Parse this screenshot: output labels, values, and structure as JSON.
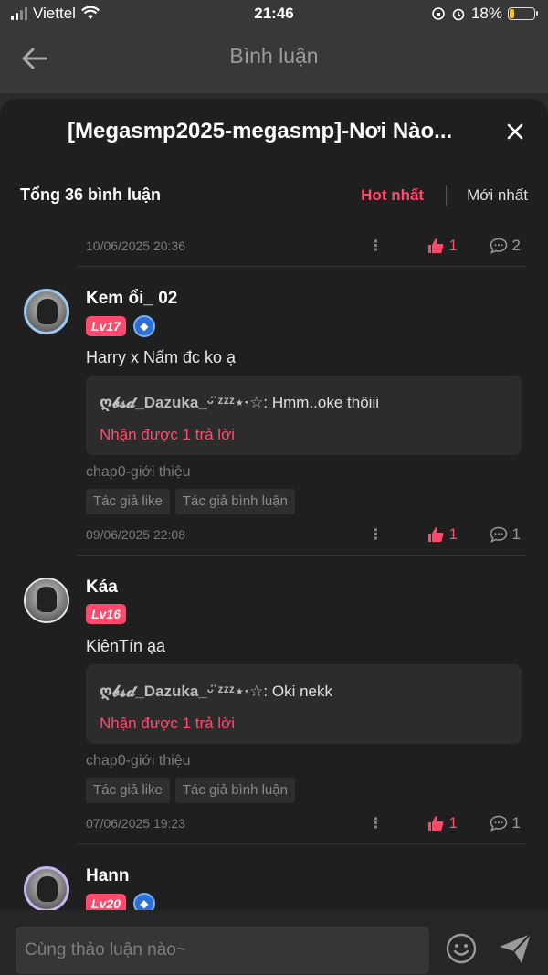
{
  "status": {
    "carrier": "Viettel",
    "time": "21:46",
    "battery": "18%",
    "battery_level": 0.18
  },
  "nav": {
    "title": "Bình luận",
    "back_icon": "back-arrow-icon"
  },
  "sheet": {
    "title": "[Megasmp2025-megasmp]-Nơi Nào...",
    "count_label": "Tổng 36 bình luận",
    "sort_hot": "Hot nhất",
    "sort_new": "Mới nhất"
  },
  "top_meta": {
    "date": "10/06/2025 20:36",
    "likes": "1",
    "replies": "2"
  },
  "comments": [
    {
      "username": "Kem ổi_ 02",
      "level": "Lv17",
      "text": "Harry x Nấm đc ko ạ",
      "reply_user": "ღ𝓫𝓼𝓭_Dazuka_ᵕ̈ ᶻᶻᶻ⋆·☆",
      "reply_text": ": Hmm..oke thôiii",
      "reply_more": "Nhận được 1 trả lời",
      "chapter": "chap0-giới thiệu",
      "tag1": "Tác giả like",
      "tag2": "Tác giả bình luận",
      "date": "09/06/2025 22:08",
      "likes": "1",
      "replies": "1"
    },
    {
      "username": "Káa",
      "level": "Lv16",
      "text": "KiênTín ạa",
      "reply_user": "ღ𝓫𝓼𝓭_Dazuka_ᵕ̈ ᶻᶻᶻ⋆·☆",
      "reply_text": ": Oki nekk",
      "reply_more": "Nhận được 1 trả lời",
      "chapter": "chap0-giới thiệu",
      "tag1": "Tác giả like",
      "tag2": "Tác giả bình luận",
      "date": "07/06/2025 19:23",
      "likes": "1",
      "replies": "1"
    },
    {
      "username": "Hann",
      "level": "Lv20"
    }
  ],
  "composer": {
    "placeholder": "Cùng thảo luận nào~"
  },
  "colors": {
    "accent": "#ff4a6e",
    "background": "#1f1f1f"
  }
}
